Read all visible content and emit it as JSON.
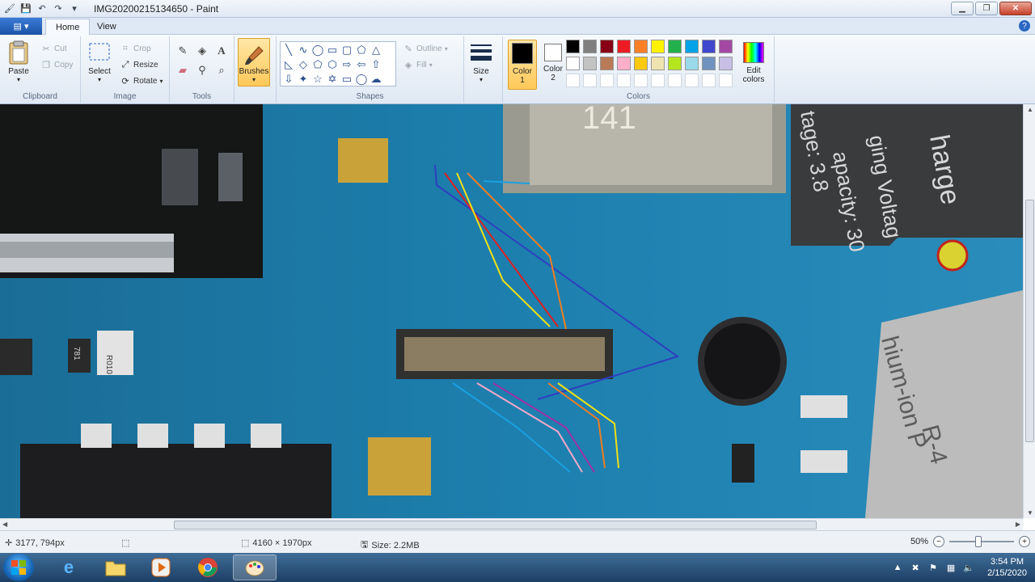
{
  "window": {
    "title": "IMG20200215134650 - Paint"
  },
  "tabs": {
    "file_icon": "menu-icon",
    "home": "Home",
    "view": "View"
  },
  "ribbon": {
    "clipboard": {
      "label": "Clipboard",
      "paste": "Paste",
      "cut": "Cut",
      "copy": "Copy"
    },
    "image": {
      "label": "Image",
      "select": "Select",
      "crop": "Crop",
      "resize": "Resize",
      "rotate": "Rotate"
    },
    "tools": {
      "label": "Tools"
    },
    "brushes": {
      "label": "Brushes"
    },
    "shapes": {
      "label": "Shapes",
      "outline": "Outline",
      "fill": "Fill"
    },
    "size": {
      "label": "Size"
    },
    "colors": {
      "label": "Colors",
      "color1_line1": "Color",
      "color1_line2": "1",
      "color2_line1": "Color",
      "color2_line2": "2",
      "edit_line1": "Edit",
      "edit_line2": "colors",
      "color1": "#000000",
      "color2": "#ffffff",
      "palette_row1": [
        "#000000",
        "#7f7f7f",
        "#880015",
        "#ed1c24",
        "#ff7f27",
        "#fff200",
        "#22b14c",
        "#00a2e8",
        "#3f48cc",
        "#a349a4"
      ],
      "palette_row2": [
        "#ffffff",
        "#c3c3c3",
        "#b97a57",
        "#ffaec9",
        "#ffc90e",
        "#efe4b0",
        "#b5e61d",
        "#99d9ea",
        "#7092be",
        "#c8bfe7"
      ],
      "palette_row3": [
        "#ffffff",
        "#ffffff",
        "#ffffff",
        "#ffffff",
        "#ffffff",
        "#ffffff",
        "#ffffff",
        "#ffffff",
        "#ffffff",
        "#ffffff"
      ]
    }
  },
  "canvas": {
    "image_text": {
      "t1": "141",
      "t2": "harge",
      "t3": "ging Voltag",
      "t4": "apacity: 30",
      "t5": "tage: 3.8",
      "t6": "hium-ion P",
      "t7": "R-4",
      "t8": "R010",
      "t9": "781"
    }
  },
  "status": {
    "cursor_pos": "3177, 794px",
    "dimensions": "4160 × 1970px",
    "size": "Size: 2.2MB",
    "zoom": "50%"
  },
  "taskbar": {
    "time": "3:54 PM",
    "date": "2/15/2020"
  }
}
